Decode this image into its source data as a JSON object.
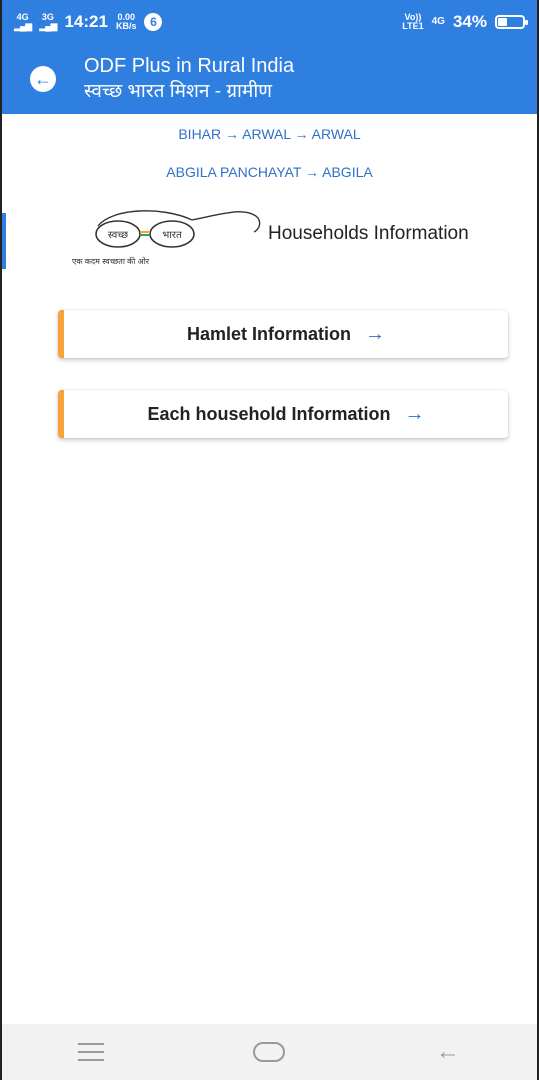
{
  "status": {
    "net1": "4G",
    "net2": "3G",
    "time": "14:21",
    "speed_value": "0.00",
    "speed_unit": "KB/s",
    "notif_count": "6",
    "volte_top": "Vo))",
    "volte_bottom": "LTE1",
    "net3": "4G",
    "battery": "34%"
  },
  "appbar": {
    "title": "ODF Plus in Rural India",
    "subtitle": "स्वच्छ भारत मिशन - ग्रामीण"
  },
  "breadcrumb": {
    "line1": "BIHAR → ARWAL → ARWAL",
    "line2": "ABGILA PANCHAYAT → ABGILA"
  },
  "logo": {
    "left_word": "स्वच्छ",
    "right_word": "भारत",
    "caption": "एक कदम स्वच्छता की ओर"
  },
  "section_title": "Households Information",
  "buttons": {
    "hamlet": "Hamlet Information",
    "household": "Each household Information",
    "arrow": "→"
  },
  "colors": {
    "primary": "#2f7fe0",
    "accent": "#f7a33a",
    "link": "#2f70c8"
  }
}
